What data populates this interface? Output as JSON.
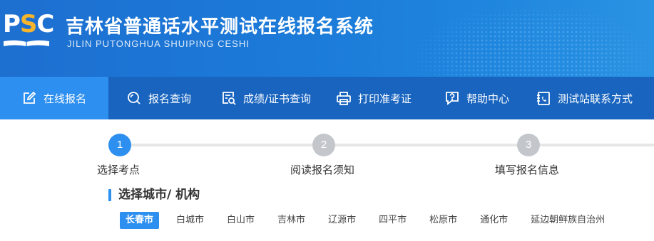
{
  "header": {
    "logo": "PSC",
    "title": "吉林省普通话水平测试在线报名系统",
    "subtitle": "JILIN PUTONGHUA SHUIPING CESHI"
  },
  "nav": {
    "items": [
      {
        "label": "在线报名",
        "icon": "edit-icon"
      },
      {
        "label": "报名查询",
        "icon": "search-icon"
      },
      {
        "label": "成绩/证书查询",
        "icon": "certificate-search-icon"
      },
      {
        "label": "打印准考证",
        "icon": "printer-icon"
      },
      {
        "label": "帮助中心",
        "icon": "help-icon"
      },
      {
        "label": "测试站联系方式",
        "icon": "phone-contact-icon"
      }
    ],
    "active_index": 0
  },
  "steps": [
    {
      "number": "1",
      "label": "选择考点",
      "active": true
    },
    {
      "number": "2",
      "label": "阅读报名须知",
      "active": false
    },
    {
      "number": "3",
      "label": "填写报名信息",
      "active": false
    }
  ],
  "section": {
    "title": "选择城市/ 机构"
  },
  "cities": {
    "items": [
      "长春市",
      "白城市",
      "白山市",
      "吉林市",
      "辽源市",
      "四平市",
      "松原市",
      "通化市",
      "延边朝鲜族自治州"
    ],
    "selected_index": 0
  },
  "colors": {
    "header_blue": "#1c7ad8",
    "nav_blue": "#1864bf",
    "accent": "#2d8ff0",
    "logo_yellow": "#f7b52c",
    "inactive_step": "#c3c7cc"
  }
}
